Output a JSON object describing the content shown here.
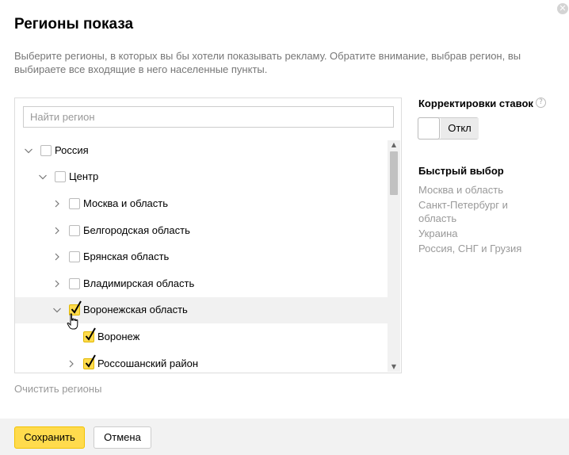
{
  "dialog": {
    "title": "Регионы показа",
    "description": "Выберите регионы, в которых вы бы хотели показывать рекламу. Обратите внимание, выбрав регион, вы выбираете все входящие в него населенные пункты.",
    "close_icon": "close-icon"
  },
  "search": {
    "placeholder": "Найти регион",
    "value": ""
  },
  "tree": [
    {
      "label": "Россия",
      "level": 0,
      "expanded": true,
      "has_children": true,
      "checked": false,
      "highlighted": false
    },
    {
      "label": "Центр",
      "level": 1,
      "expanded": true,
      "has_children": true,
      "checked": false,
      "highlighted": false
    },
    {
      "label": "Москва и область",
      "level": 2,
      "expanded": false,
      "has_children": true,
      "checked": false,
      "highlighted": false
    },
    {
      "label": "Белгородская область",
      "level": 2,
      "expanded": false,
      "has_children": true,
      "checked": false,
      "highlighted": false
    },
    {
      "label": "Брянская область",
      "level": 2,
      "expanded": false,
      "has_children": true,
      "checked": false,
      "highlighted": false
    },
    {
      "label": "Владимирская область",
      "level": 2,
      "expanded": false,
      "has_children": true,
      "checked": false,
      "highlighted": false
    },
    {
      "label": "Воронежская область",
      "level": 2,
      "expanded": true,
      "has_children": true,
      "checked": true,
      "highlighted": true
    },
    {
      "label": "Воронеж",
      "level": 3,
      "expanded": false,
      "has_children": false,
      "checked": true,
      "highlighted": false
    },
    {
      "label": "Россошанский район",
      "level": 3,
      "expanded": false,
      "has_children": true,
      "checked": true,
      "highlighted": false
    }
  ],
  "clear_regions_label": "Очистить регионы",
  "bid_adjustments": {
    "heading": "Корректировки ставок",
    "help_icon": "question-circle-icon",
    "toggle_label": "Откл",
    "enabled": false
  },
  "quick_select": {
    "heading": "Быстрый выбор",
    "items": [
      "Москва и область",
      "Санкт-Петербург и область",
      "Украина",
      "Россия, СНГ и Грузия"
    ]
  },
  "footer": {
    "save_label": "Сохранить",
    "cancel_label": "Отмена"
  },
  "colors": {
    "accent": "#ffdb4d",
    "highlight_row": "#f1f1f1",
    "muted_text": "#999999",
    "footer_bg": "#f2f2f2"
  }
}
